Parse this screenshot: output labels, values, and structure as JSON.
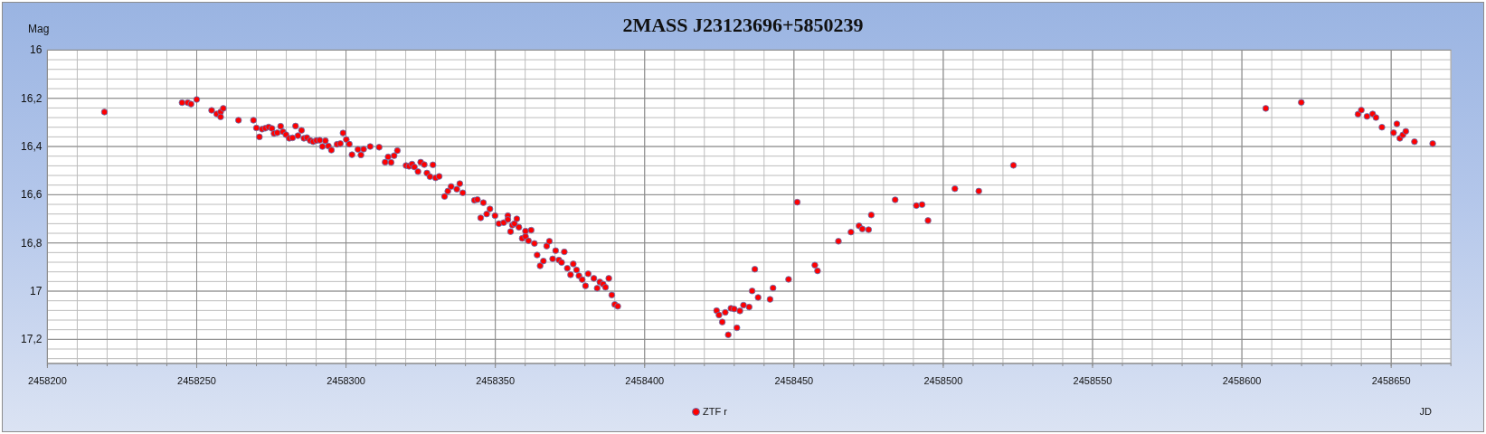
{
  "chart": {
    "chart_data": {
      "type": "scatter",
      "title": "2MASS J23123696+5850239",
      "xlabel": "JD",
      "ylabel": "Mag",
      "grid": true,
      "xlim": [
        2458200,
        2458670
      ],
      "ylim": [
        17.3,
        16
      ],
      "xticks": [
        2458200,
        2458250,
        2458300,
        2458350,
        2458400,
        2458450,
        2458500,
        2458550,
        2458600,
        2458650
      ],
      "yticks": [
        {
          "value": 16,
          "label": "16"
        },
        {
          "value": 16.2,
          "label": "16,2"
        },
        {
          "value": 16.4,
          "label": "16,4"
        },
        {
          "value": 16.6,
          "label": "16,6"
        },
        {
          "value": 16.8,
          "label": "16,8"
        },
        {
          "value": 17,
          "label": "17"
        },
        {
          "value": 17.2,
          "label": "17,2"
        }
      ],
      "x": [
        2458219.1,
        2458245.1,
        2458247.0,
        2458248.1,
        2458250.0,
        2458255.0,
        2458256.7,
        2458258.0,
        2458258.0,
        2458258.9,
        2458264.0,
        2458269.0,
        2458270.0,
        2458271.0,
        2458271.9,
        2458273.0,
        2458274.1,
        2458275.2,
        2458275.9,
        2458277.0,
        2458278.1,
        2458278.9,
        2458279.9,
        2458281.0,
        2458282.1,
        2458283.1,
        2458283.9,
        2458285.1,
        2458285.9,
        2458286.9,
        2458288.0,
        2458289.0,
        2458290.1,
        2458291.2,
        2458292.1,
        2458293.1,
        2458294.1,
        2458295.1,
        2458297.0,
        2458298.1,
        2458299.0,
        2458300.1,
        2458301.1,
        2458302.0,
        2458304.0,
        2458305.0,
        2458305.9,
        2458308.1,
        2458311.1,
        2458313.1,
        2458314.1,
        2458315.1,
        2458316.1,
        2458317.2,
        2458320.1,
        2458321.1,
        2458322.1,
        2458322.9,
        2458324.1,
        2458325.0,
        2458326.2,
        2458327.1,
        2458328.1,
        2458329.1,
        2458330.0,
        2458331.2,
        2458333.0,
        2458334.1,
        2458335.2,
        2458337.1,
        2458338.1,
        2458339.1,
        2458343.0,
        2458344.0,
        2458345.1,
        2458346.0,
        2458347.1,
        2458348.2,
        2458349.9,
        2458351.2,
        2458352.8,
        2458354.2,
        2458354.2,
        2458355.1,
        2458355.7,
        2458356.4,
        2458357.2,
        2458357.9,
        2458359.0,
        2458360.1,
        2458360.1,
        2458361.1,
        2458362.0,
        2458363.1,
        2458364.0,
        2458365.0,
        2458366.1,
        2458367.2,
        2458368.1,
        2458369.2,
        2458370.2,
        2458371.3,
        2458372.2,
        2458373.1,
        2458374.1,
        2458375.2,
        2458376.1,
        2458377.2,
        2458378.0,
        2458379.1,
        2458380.2,
        2458381.1,
        2458383.0,
        2458384.1,
        2458385.0,
        2458386.1,
        2458386.9,
        2458388.0,
        2458389.0,
        2458390.0,
        2458391.0,
        2458424.1,
        2458424.9,
        2458426.0,
        2458427.0,
        2458428.0,
        2458428.9,
        2458430.0,
        2458430.9,
        2458431.9,
        2458433.1,
        2458435.0,
        2458436.0,
        2458436.9,
        2458438.0,
        2458442.0,
        2458443.0,
        2458448.2,
        2458451.1,
        2458457.0,
        2458457.9,
        2458464.9,
        2458469.1,
        2458471.8,
        2458472.9,
        2458475.0,
        2458475.9,
        2458483.9,
        2458491.0,
        2458492.9,
        2458494.9,
        2458503.9,
        2458511.9,
        2458523.5,
        2458608.0,
        2458619.9,
        2458638.9,
        2458640.0,
        2458641.9,
        2458643.8,
        2458644.9,
        2458646.9,
        2458650.8,
        2458651.9,
        2458652.9,
        2458653.9,
        2458654.9,
        2458657.8,
        2458663.9
      ],
      "series": [
        {
          "name": "ZTF r",
          "color": "#ff0000",
          "values": [
            16.257,
            16.218,
            16.218,
            16.224,
            16.205,
            16.25,
            16.265,
            16.257,
            16.277,
            16.242,
            16.291,
            16.291,
            16.323,
            16.36,
            16.328,
            16.324,
            16.319,
            16.325,
            16.346,
            16.343,
            16.316,
            16.339,
            16.351,
            16.366,
            16.364,
            16.315,
            16.355,
            16.333,
            16.366,
            16.363,
            16.375,
            16.38,
            16.375,
            16.374,
            16.4,
            16.376,
            16.398,
            16.415,
            16.391,
            16.388,
            16.344,
            16.371,
            16.39,
            16.434,
            16.412,
            16.435,
            16.411,
            16.4,
            16.403,
            16.465,
            16.443,
            16.466,
            16.438,
            16.417,
            16.479,
            16.482,
            16.473,
            16.485,
            16.504,
            16.465,
            16.475,
            16.51,
            16.525,
            16.476,
            16.53,
            16.524,
            16.607,
            16.585,
            16.566,
            16.577,
            16.554,
            16.592,
            16.623,
            16.62,
            16.696,
            16.633,
            16.68,
            16.659,
            16.687,
            16.72,
            16.716,
            16.687,
            16.703,
            16.753,
            16.726,
            16.72,
            16.7,
            16.735,
            16.781,
            16.773,
            16.751,
            16.791,
            16.747,
            16.802,
            16.85,
            16.895,
            16.875,
            16.813,
            16.793,
            16.866,
            16.832,
            16.871,
            16.881,
            16.837,
            16.905,
            16.932,
            16.887,
            16.912,
            16.936,
            16.952,
            16.978,
            16.928,
            16.947,
            16.988,
            16.962,
            16.971,
            16.984,
            16.947,
            17.016,
            17.055,
            17.063,
            17.081,
            17.099,
            17.128,
            17.088,
            17.181,
            17.071,
            17.074,
            17.152,
            17.082,
            17.058,
            17.066,
            16.999,
            16.909,
            17.026,
            17.034,
            16.987,
            16.951,
            16.631,
            16.892,
            16.916,
            16.793,
            16.755,
            16.729,
            16.742,
            16.745,
            16.684,
            16.621,
            16.645,
            16.641,
            16.707,
            16.575,
            16.585,
            16.478,
            16.242,
            16.217,
            16.266,
            16.249,
            16.275,
            16.265,
            16.28,
            16.32,
            16.343,
            16.306,
            16.366,
            16.352,
            16.337,
            16.38,
            16.388
          ]
        }
      ]
    }
  }
}
